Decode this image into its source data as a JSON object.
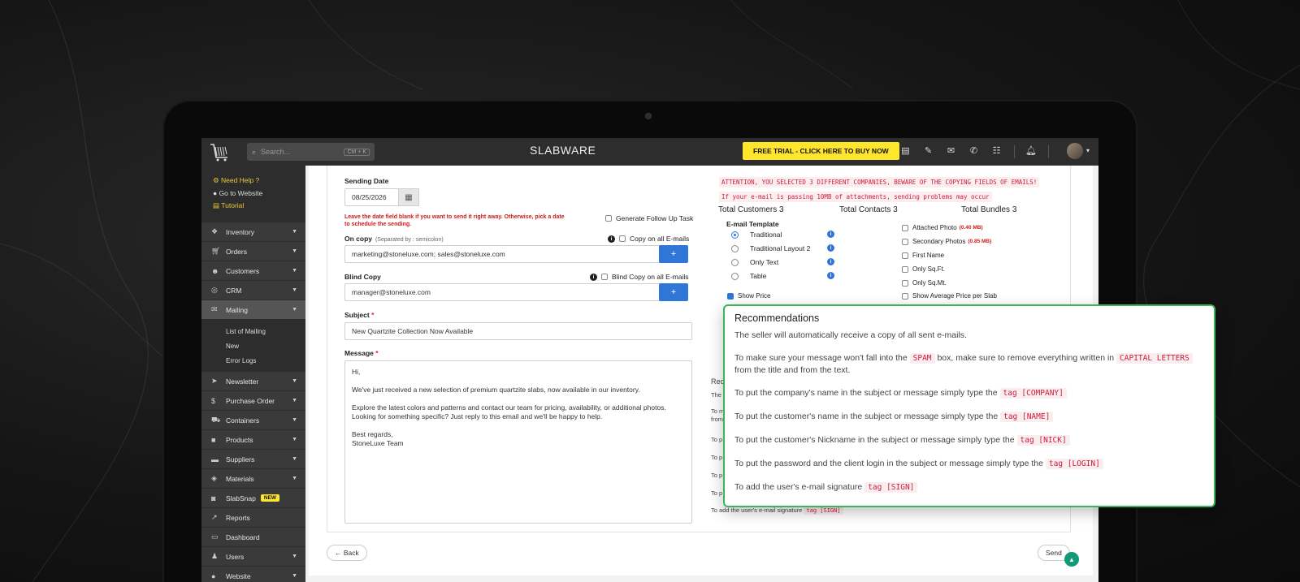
{
  "topbar": {
    "search_placeholder": "Search...",
    "search_shortcut": "Ctrl + K",
    "brand": "SLABWARE",
    "trial_button": "FREE TRIAL - CLICK HERE TO BUY NOW"
  },
  "sidebar": {
    "help": "Need Help ?",
    "website": "Go to Website",
    "tutorial": "Tutorial",
    "items": {
      "inventory": "Inventory",
      "orders": "Orders",
      "customers": "Customers",
      "crm": "CRM",
      "mailing": "Mailing",
      "newsletter": "Newsletter",
      "purchase_order": "Purchase Order",
      "containers": "Containers",
      "products": "Products",
      "suppliers": "Suppliers",
      "materials": "Materials",
      "slabsnap": "SlabSnap",
      "reports": "Reports",
      "dashboard": "Dashboard",
      "users": "Users",
      "website": "Website"
    },
    "mailing_sub": {
      "list": "List of Mailing",
      "new": "New",
      "errors": "Error Logs"
    },
    "new_badge": "NEW"
  },
  "form": {
    "sending_date_label": "Sending Date",
    "sending_date_value": "08/25/2026",
    "date_warning_line1": "Leave the date field blank if you want to send it right away. Otherwise, pick a date",
    "date_warning_line2": "to schedule the sending.",
    "follow_up": "Generate Follow Up Task",
    "on_copy_label": "On copy",
    "on_copy_hint": "(Separated by : semicolon)",
    "copy_all": "Copy on all E-mails",
    "on_copy_value": "marketing@stoneluxe.com; sales@stoneluxe.com",
    "blind_copy_label": "Blind Copy",
    "blind_copy_all": "Blind Copy on all E-mails",
    "blind_copy_value": "manager@stoneluxe.com",
    "subject_label": "Subject",
    "subject_value": "New Quartzite Collection Now Available",
    "message_label": "Message",
    "message": {
      "greeting": "Hi,",
      "p1": "We've just received a new selection of premium quartzite slabs, now available in our inventory.",
      "p2a": "Explore the latest colors and patterns and contact our team for pricing, availability, or additional photos.",
      "p2b": "Looking for something specific? Just reply to this email and we'll be happy to help.",
      "closing": "Best regards,",
      "signature": "StoneLuxe Team"
    },
    "plus": "+",
    "required_mark": "*"
  },
  "right": {
    "warn1": "ATTENTION, YOU SELECTED 3 DIFFERENT COMPANIES, BEWARE OF THE COPYING FIELDS OF EMAILS!",
    "warn2": "If your e-mail is passing 10MB of attachments, sending problems may occur",
    "total_customers": "Total Customers 3",
    "total_contacts": "Total Contacts 3",
    "total_bundles": "Total Bundles 3",
    "template_label": "E-mail Template",
    "templates": [
      "Traditional",
      "Traditional Layout 2",
      "Only Text",
      "Table"
    ],
    "show_price": "Show Price",
    "options": {
      "attached_photo": "Attached Photo",
      "attached_size": "(0.40 MB)",
      "secondary_photos": "Secondary Photos",
      "secondary_size": "(0.85 MB)",
      "first_name": "First Name",
      "only_sqft": "Only Sq.Ft.",
      "only_sqmt": "Only Sq.Mt.",
      "avg_price": "Show Average Price per Slab"
    },
    "ghost_rec_title": "Rec",
    "ghost_the": "The",
    "ghost_to1": "To m",
    "ghost_from": "from",
    "ghost_to": "To p",
    "ghost_sign": "To add the user's e-mail signature",
    "ghost_sign_tag": "tag [SIGN]"
  },
  "footer": {
    "back": "← Back",
    "send": "Send"
  },
  "popup": {
    "title": "Recommendations",
    "r1": "The seller will automatically receive a copy of all sent e-mails.",
    "r2a": "To make sure your message won't fall into the",
    "r2_spam": "SPAM",
    "r2b": "box, make sure to remove everything written in",
    "r2_caps": "CAPITAL LETTERS",
    "r2c": "from the title and from the text.",
    "r3": "To put the company's name in the subject or message simply type the",
    "r3_tag": "tag [COMPANY]",
    "r4": "To put the customer's name in the subject or message simply type the",
    "r4_tag": "tag [NAME]",
    "r5": "To put the customer's Nickname in the subject or message simply type the",
    "r5_tag": "tag [NICK]",
    "r6": "To put the password and the client login in the subject or message simply type the",
    "r6_tag": "tag [LOGIN]",
    "r7": "To add the user's e-mail signature",
    "r7_tag": "tag [SIGN]"
  },
  "colors": {
    "accent_yellow": "#ffe52b",
    "primary_blue": "#2f76d6",
    "popup_border": "#3bb55a",
    "warning_red": "#d01b1b"
  }
}
